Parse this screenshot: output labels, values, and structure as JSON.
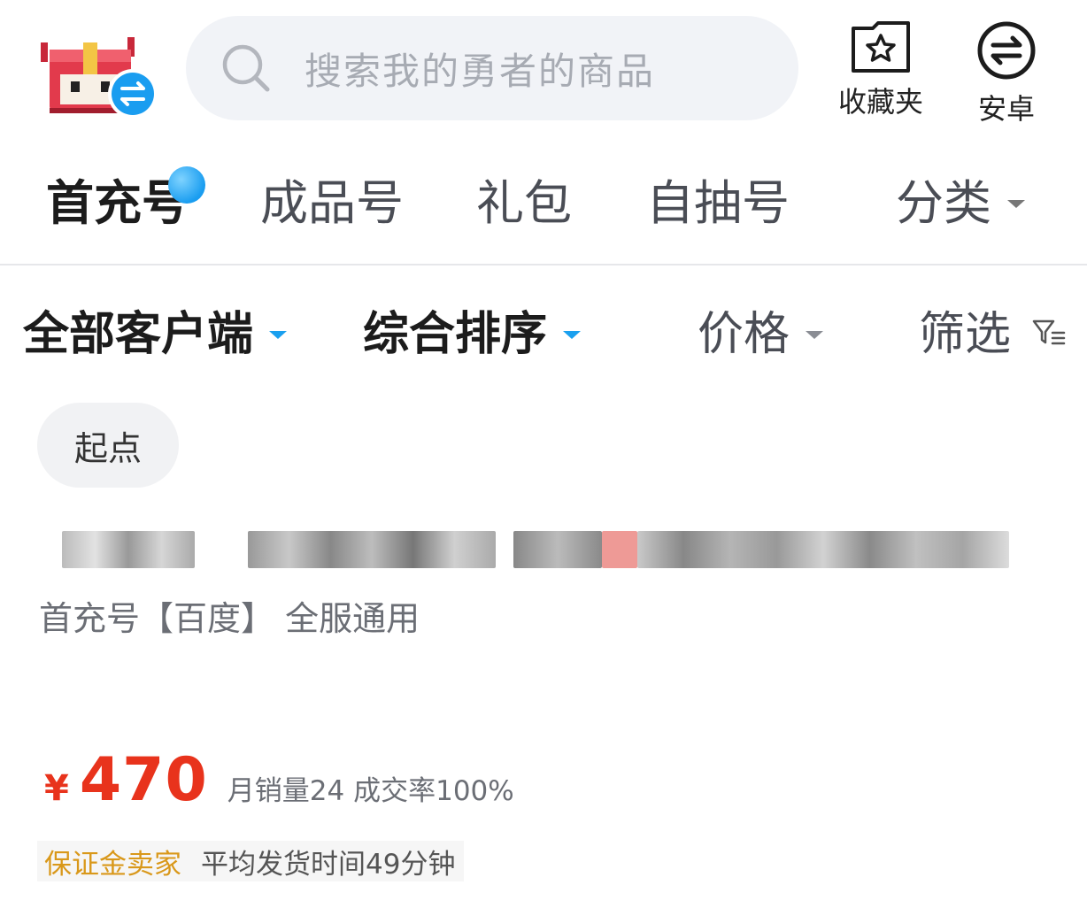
{
  "header": {
    "search_placeholder": "搜索我的勇者的商品",
    "favorites_label": "收藏夹",
    "platform_label": "安卓"
  },
  "tabs": [
    {
      "label": "首充号",
      "active": true,
      "has_dot": true
    },
    {
      "label": "成品号",
      "active": false
    },
    {
      "label": "礼包",
      "active": false
    },
    {
      "label": "自抽号",
      "active": false
    },
    {
      "label": "分类",
      "active": false,
      "dropdown": true
    }
  ],
  "sort_bar": {
    "client": "全部客户端",
    "sort": "综合排序",
    "price": "价格",
    "filter": "筛选"
  },
  "chip": {
    "label": "起点"
  },
  "listing": {
    "subtitle": "首充号【百度】 全服通用",
    "currency": "¥",
    "price": "470",
    "stats": "月销量24 成交率100%",
    "seller_badge": "保证金卖家",
    "ship_time": "平均发货时间49分钟"
  },
  "colors": {
    "accent_blue": "#1aa0ef",
    "price_red": "#e8331c",
    "badge_orange": "#d9981a"
  },
  "icons": [
    "app-logo-icon",
    "swap-icon",
    "search-icon",
    "favorites-star-icon",
    "android-swap-icon",
    "filter-icon"
  ]
}
